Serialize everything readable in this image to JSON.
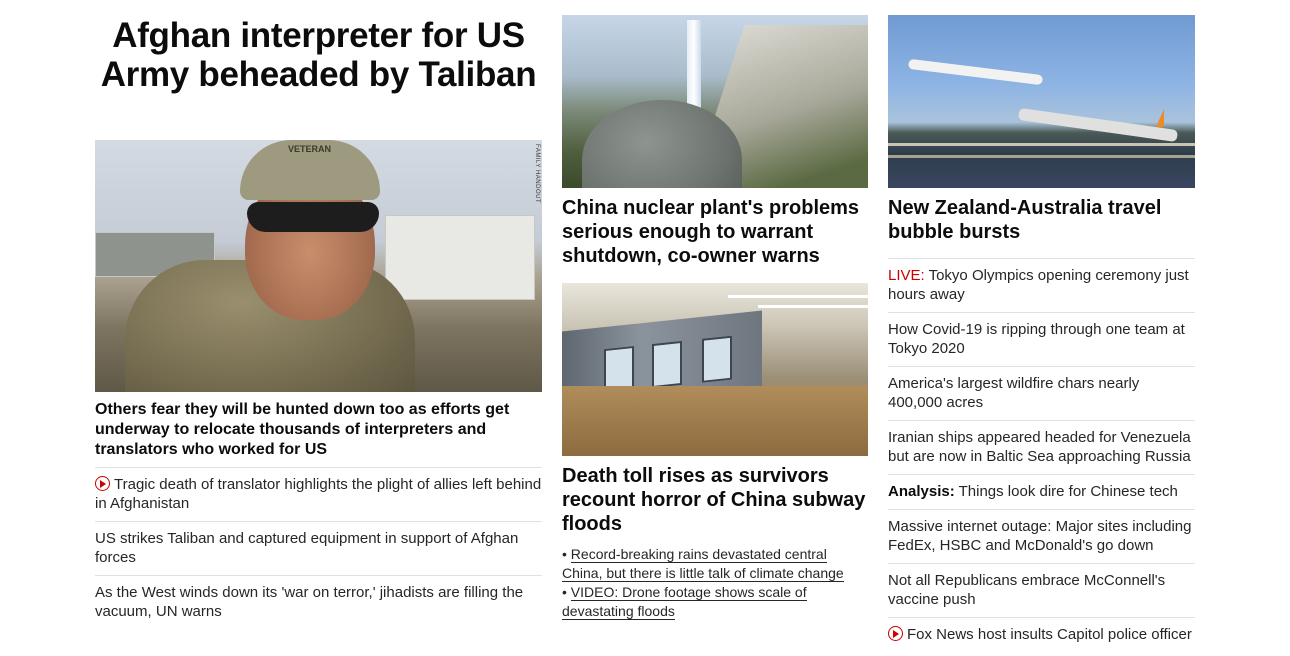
{
  "left": {
    "headline": "Afghan interpreter for US Army beheaded by Taliban",
    "image_credit": "FAMILY HANDOUT",
    "image_text": "VETERAN",
    "subheadline": "Others fear they will be hunted down too as efforts get underway to relocate thousands of interpreters and translators who worked for US",
    "links": [
      {
        "text": "Tragic death of translator highlights the plight of allies left behind in Afghanistan",
        "icon": "play-icon"
      },
      {
        "text": "US strikes Taliban and captured equipment in support of Afghan forces"
      },
      {
        "text": "As the West winds down its 'war on terror,' jihadists are filling the vacuum, UN warns"
      }
    ]
  },
  "middle": {
    "card1_title": "China nuclear plant's problems serious enough to warrant shutdown, co-owner warns",
    "card2_title": "Death toll rises as survivors recount horror of China subway floods",
    "card2_bullets": [
      "Record-breaking rains devastated central China, but there is little talk of climate change",
      "VIDEO: Drone footage shows scale of devastating floods"
    ]
  },
  "right": {
    "title": "New Zealand-Australia travel bubble bursts",
    "items": [
      {
        "tag": "LIVE:",
        "tag_style": "live",
        "text": "Tokyo Olympics opening ceremony just hours away"
      },
      {
        "text": "How Covid-19 is ripping through one team at Tokyo 2020"
      },
      {
        "text": "America's largest wildfire chars nearly 400,000 acres"
      },
      {
        "text": "Iranian ships appeared headed for Venezuela but are now in Baltic Sea approaching Russia"
      },
      {
        "tag": "Analysis:",
        "tag_style": "analysis",
        "text": "Things look dire for Chinese tech"
      },
      {
        "text": "Massive internet outage: Major sites including FedEx, HSBC and McDonald's go down"
      },
      {
        "text": "Not all Republicans embrace McConnell's vaccine push"
      },
      {
        "text": "Fox News host insults Capitol police officer",
        "icon": "play-icon"
      }
    ]
  },
  "colors": {
    "accent_red": "#cc0000",
    "text": "#262626",
    "heading": "#0c0c0c",
    "divider": "#e1e1e1"
  }
}
